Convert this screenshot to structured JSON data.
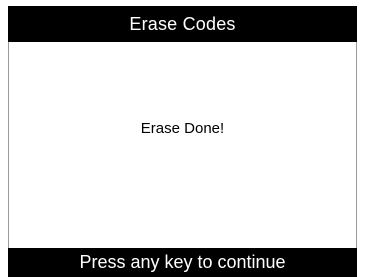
{
  "header": {
    "title": "Erase Codes"
  },
  "main": {
    "message": "Erase Done!"
  },
  "footer": {
    "prompt": "Press any key to continue"
  },
  "colors": {
    "bar_background": "#000000",
    "bar_text": "#ffffff",
    "screen_background": "#ffffff",
    "message_text": "#000000"
  }
}
